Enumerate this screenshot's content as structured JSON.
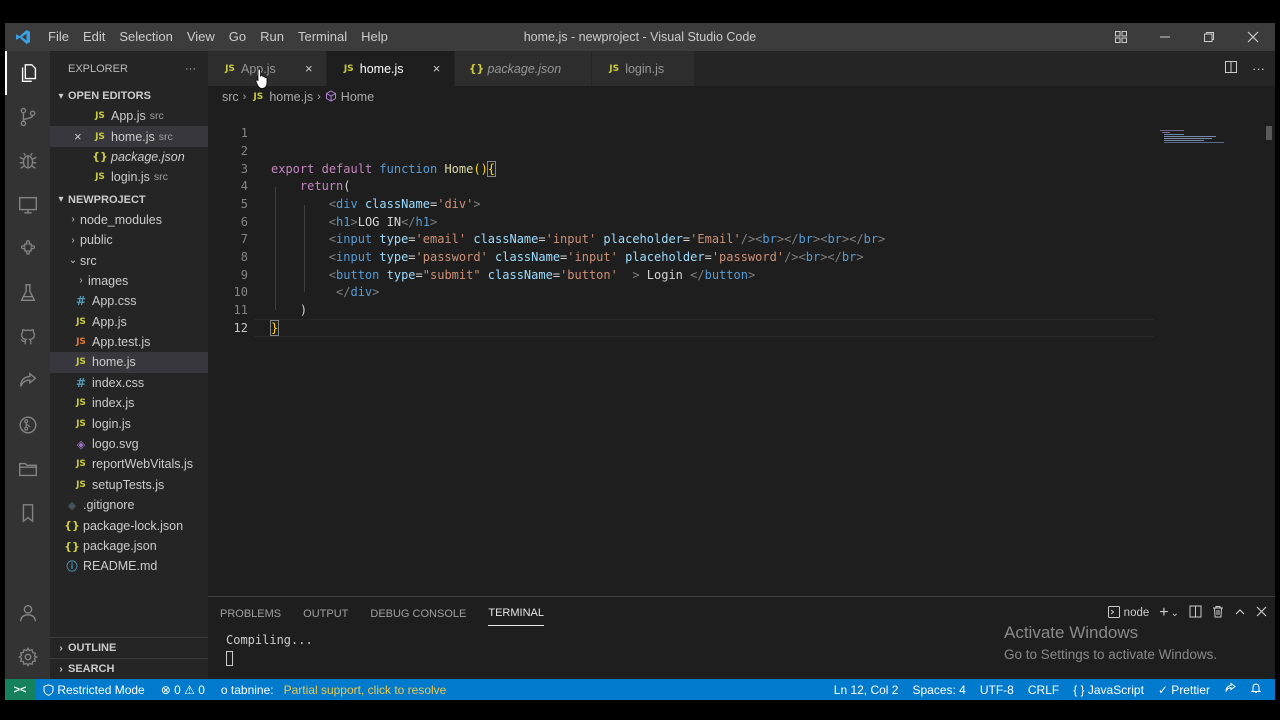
{
  "window": {
    "title": "home.js - newproject - Visual Studio Code",
    "menu": [
      "File",
      "Edit",
      "Selection",
      "View",
      "Go",
      "Run",
      "Terminal",
      "Help"
    ],
    "controls": [
      "layout-icon",
      "minimize-icon",
      "restore-icon",
      "close-icon"
    ]
  },
  "activity_bar": [
    "explorer-icon",
    "source-control-icon",
    "debug-icon",
    "remote-explorer-icon",
    "extensions-icon",
    "testing-icon",
    "github-icon",
    "live-share-icon",
    "gitlens-icon",
    "folder-icon",
    "bookmark-icon",
    "account-icon",
    "settings-gear-icon"
  ],
  "sidebar": {
    "title": "EXPLORER",
    "more": "···",
    "open_editors": {
      "label": "OPEN EDITORS",
      "items": [
        {
          "icon": "JS",
          "name": "App.js",
          "desc": "src"
        },
        {
          "icon": "JS",
          "name": "home.js",
          "desc": "src"
        },
        {
          "icon": "{}",
          "name": "package.json",
          "desc": ""
        },
        {
          "icon": "JS",
          "name": "login.js",
          "desc": "src"
        }
      ]
    },
    "project": {
      "label": "NEWPROJECT",
      "items": [
        {
          "name": "node_modules"
        },
        {
          "name": "public"
        },
        {
          "name": "src"
        },
        {
          "name": "images"
        },
        {
          "icon": "#",
          "name": "App.css"
        },
        {
          "icon": "JS",
          "name": "App.js"
        },
        {
          "icon": "JS",
          "name": "App.test.js"
        },
        {
          "icon": "JS",
          "name": "home.js"
        },
        {
          "icon": "#",
          "name": "index.css"
        },
        {
          "icon": "JS",
          "name": "index.js"
        },
        {
          "icon": "JS",
          "name": "login.js"
        },
        {
          "icon": "◈",
          "name": "logo.svg"
        },
        {
          "icon": "JS",
          "name": "reportWebVitals.js"
        },
        {
          "icon": "JS",
          "name": "setupTests.js"
        },
        {
          "icon": "◆",
          "name": ".gitignore"
        },
        {
          "icon": "{}",
          "name": "package-lock.json"
        },
        {
          "icon": "{}",
          "name": "package.json"
        },
        {
          "icon": "ⓘ",
          "name": "README.md"
        }
      ]
    },
    "outline": "OUTLINE",
    "search": "SEARCH"
  },
  "tabs": [
    {
      "icon": "JS",
      "label": "App.js",
      "close": "×"
    },
    {
      "icon": "JS",
      "label": "home.js",
      "close": "×"
    },
    {
      "icon": "{}",
      "label": "package.json"
    },
    {
      "icon": "JS",
      "label": "login.js"
    }
  ],
  "breadcrumb": {
    "folder": "src",
    "file_icon": "JS",
    "file": "home.js",
    "symbol": "Home"
  },
  "editor": {
    "line_numbers": [
      "1",
      "2",
      "3",
      "4",
      "5",
      "6",
      "7",
      "8",
      "9",
      "10",
      "11",
      "12"
    ],
    "current_line": "12"
  },
  "panel": {
    "tabs": [
      "PROBLEMS",
      "OUTPUT",
      "DEBUG CONSOLE",
      "TERMINAL"
    ],
    "active_tab": "TERMINAL",
    "terminal_name": "node",
    "terminal_output": "Compiling...",
    "watermark_line1": "Activate Windows",
    "watermark_line2": "Go to Settings to activate Windows."
  },
  "status_bar": {
    "remote": "><",
    "restricted": "Restricted Mode",
    "problems": "⊗ 0 ⚠ 0",
    "tabnine": "o tabnine:",
    "tabnine_msg": "Partial support, click to resolve",
    "position": "Ln 12, Col 2",
    "spaces": "Spaces: 4",
    "encoding": "UTF-8",
    "eol": "CRLF",
    "language": "{ } JavaScript",
    "formatter": "✓ Prettier"
  },
  "colors": {
    "accent": "#007acc",
    "remote": "#16825d",
    "tabnine": "#f0c74a"
  }
}
